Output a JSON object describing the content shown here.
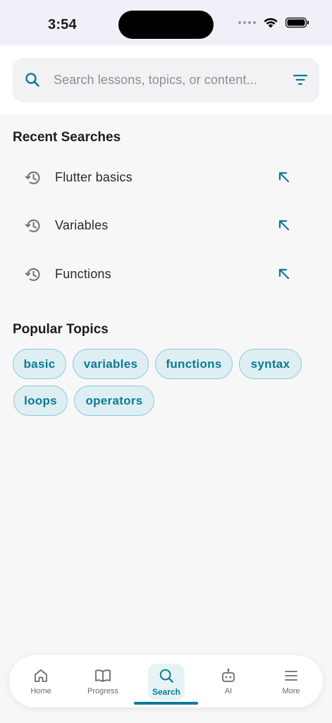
{
  "status": {
    "time": "3:54"
  },
  "search": {
    "placeholder": "Search lessons, topics, or content..."
  },
  "recent": {
    "title": "Recent Searches",
    "items": [
      {
        "label": "Flutter basics"
      },
      {
        "label": "Variables"
      },
      {
        "label": "Functions"
      }
    ]
  },
  "popular": {
    "title": "Popular Topics",
    "chips": [
      "basic",
      "variables",
      "functions",
      "syntax",
      "loops",
      "operators"
    ]
  },
  "nav": {
    "items": [
      {
        "label": "Home",
        "icon": "home-icon"
      },
      {
        "label": "Progress",
        "icon": "book-icon"
      },
      {
        "label": "Search",
        "icon": "search-icon",
        "active": true
      },
      {
        "label": "AI",
        "icon": "robot-icon"
      },
      {
        "label": "More",
        "icon": "menu-icon"
      }
    ]
  },
  "colors": {
    "accent": "#0b7b93",
    "chip_bg": "#ddeff3",
    "chip_border": "#8fcad8"
  }
}
